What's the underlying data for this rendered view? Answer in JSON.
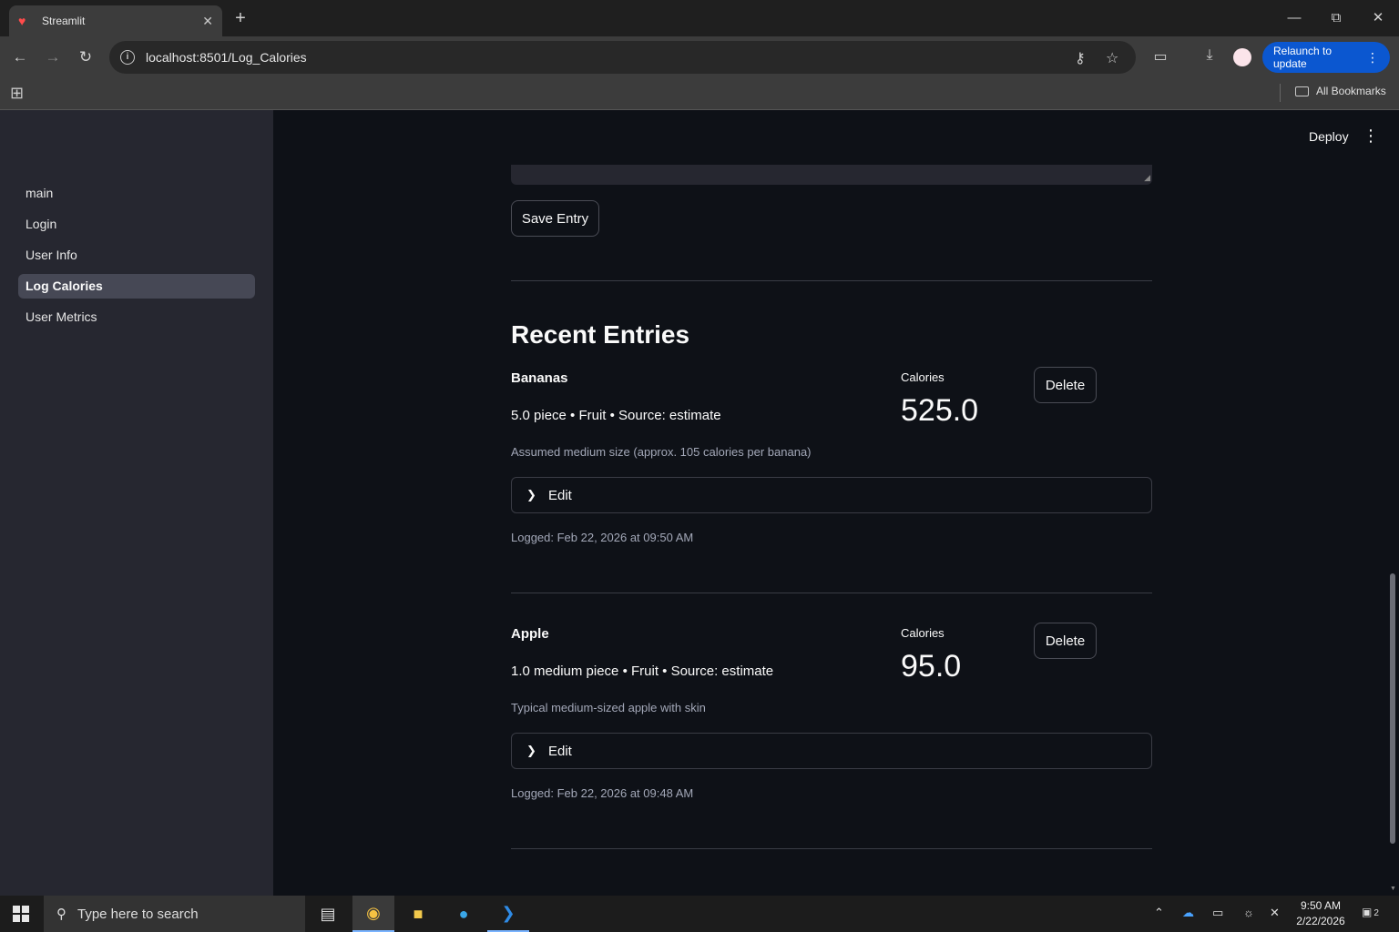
{
  "browser": {
    "tab_title": "Streamlit",
    "url": "localhost:8501/Log_Calories",
    "relaunch_label": "Relaunch to update",
    "bookmarks_label": "All Bookmarks"
  },
  "sidebar": {
    "items": [
      {
        "label": "main"
      },
      {
        "label": "Login"
      },
      {
        "label": "User Info"
      },
      {
        "label": "Log Calories",
        "active": true
      },
      {
        "label": "User Metrics"
      }
    ]
  },
  "header": {
    "deploy_label": "Deploy"
  },
  "form": {
    "save_label": "Save Entry"
  },
  "recent": {
    "heading": "Recent Entries",
    "metric_label": "Calories",
    "delete_label": "Delete",
    "edit_label": "Edit",
    "entries": [
      {
        "name": "Bananas",
        "meta": "5.0 piece • Fruit • Source: estimate",
        "note": "Assumed medium size (approx. 105 calories per banana)",
        "calories": "525.0",
        "logged": "Logged: Feb 22, 2026 at 09:50 AM"
      },
      {
        "name": "Apple",
        "meta": "1.0 medium piece • Fruit • Source: estimate",
        "note": "Typical medium-sized apple with skin",
        "calories": "95.0",
        "logged": "Logged: Feb 22, 2026 at 09:48 AM"
      }
    ]
  },
  "taskbar": {
    "search_placeholder": "Type here to search",
    "time": "9:50 AM",
    "date": "2/22/2026",
    "notification_count": "2"
  },
  "colors": {
    "app_bg": "#0e1117",
    "sidebar_bg": "#262730",
    "accent_blue": "#0b57d0"
  }
}
